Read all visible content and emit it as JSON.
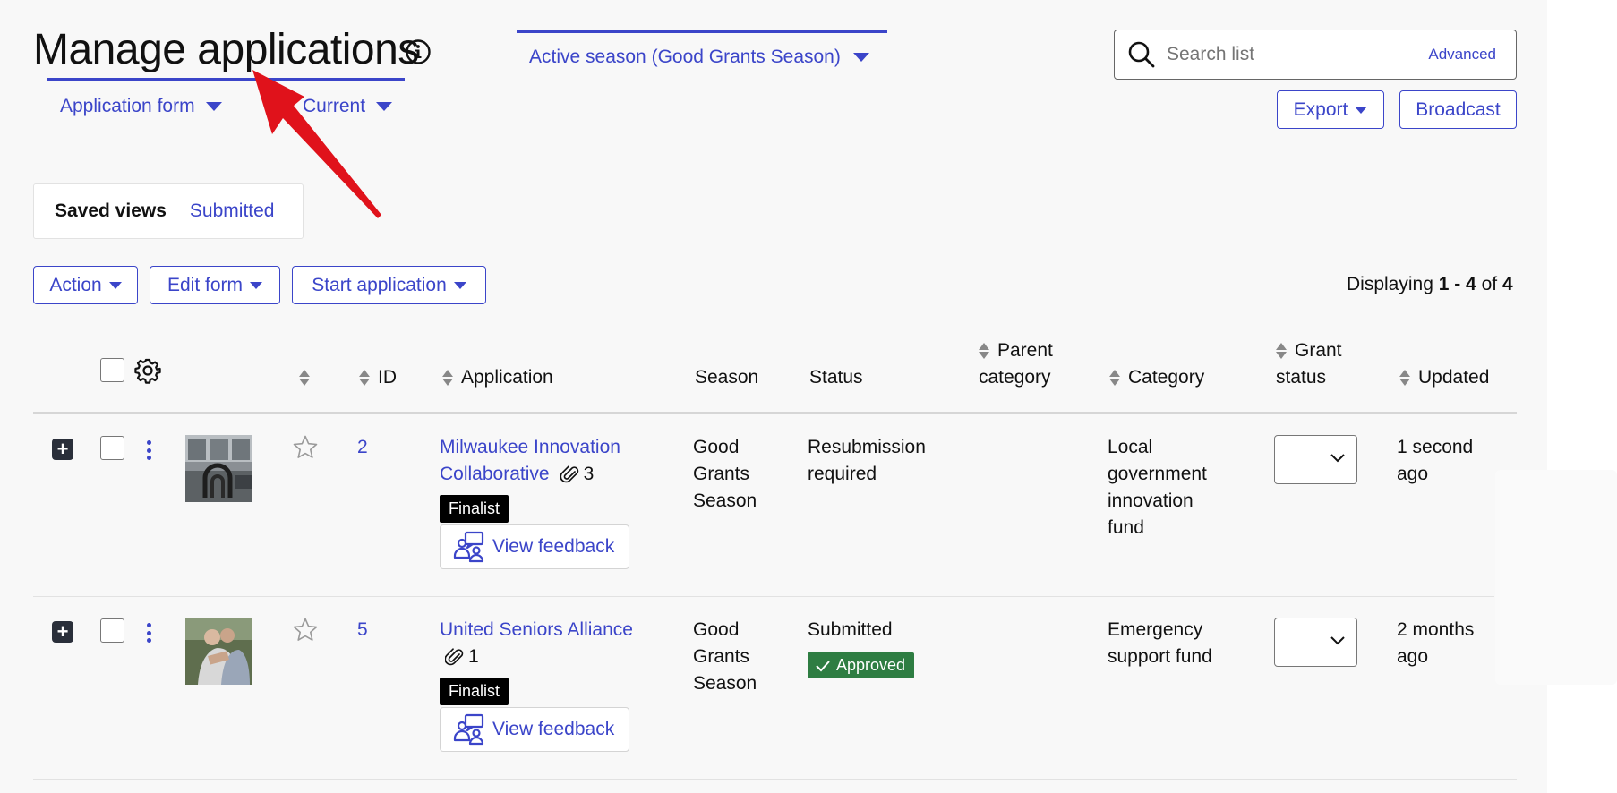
{
  "header": {
    "title": "Manage applications",
    "season_label": "Active season (Good Grants Season)",
    "filters": [
      "Application form",
      "Current"
    ],
    "search": {
      "placeholder": "Search list",
      "advanced_label": "Advanced"
    },
    "export_label": "Export",
    "broadcast_label": "Broadcast"
  },
  "saved_views": {
    "label": "Saved views",
    "items": [
      "Submitted"
    ]
  },
  "toolbar": {
    "action_label": "Action",
    "edit_form_label": "Edit form",
    "start_application_label": "Start application"
  },
  "pagination": {
    "prefix": "Displaying ",
    "range": "1 - 4",
    "of": " of ",
    "total": "4"
  },
  "table": {
    "columns": {
      "id": "ID",
      "application": "Application",
      "season": "Season",
      "status": "Status",
      "parent_category_1": "Parent",
      "parent_category_2": "category",
      "category": "Category",
      "grant_status_1": "Grant",
      "grant_status_2": "status",
      "updated": "Updated"
    },
    "rows": [
      {
        "id": "2",
        "app_line1": "Milwaukee Innovation",
        "app_line2": "Collaborative",
        "attachments": "3",
        "badge": "Finalist",
        "feedback_label": "View feedback",
        "season_l1": "Good",
        "season_l2": "Grants",
        "season_l3": "Season",
        "status_l1": "Resubmission",
        "status_l2": "required",
        "category_l1": "Local",
        "category_l2": "government",
        "category_l3": "innovation",
        "category_l4": "fund",
        "updated_l1": "1 second",
        "updated_l2": "ago"
      },
      {
        "id": "5",
        "app_line1": "United Seniors Alliance",
        "attachments": "1",
        "badge": "Finalist",
        "feedback_label": "View feedback",
        "season_l1": "Good",
        "season_l2": "Grants",
        "season_l3": "Season",
        "status_l1": "Submitted",
        "approved_label": "Approved",
        "category_l1": "Emergency",
        "category_l2": "support fund",
        "updated_l1": "2 months",
        "updated_l2": "ago"
      }
    ]
  },
  "colors": {
    "accent": "#3b45c9",
    "approved": "#2e7d42",
    "annotation_arrow": "#e0121b"
  }
}
